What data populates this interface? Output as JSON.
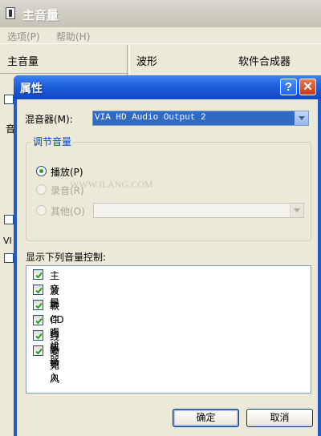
{
  "background_window": {
    "title": "主音量",
    "menu": [
      "选项(P)",
      "帮助(H)"
    ],
    "columns": [
      "主音量",
      "波形",
      "软件合成器"
    ],
    "fragments": {
      "vol_char": "音",
      "vi_text": "VI"
    }
  },
  "dialog": {
    "title": "属性",
    "help_glyph": "?",
    "close_glyph": "✕",
    "mixer": {
      "label": "混音器(M):",
      "value": "VIA HD Audio Output 2"
    },
    "adjust_group": {
      "label": "调节音量",
      "options": [
        {
          "label": "播放(P)",
          "selected": true,
          "enabled": true
        },
        {
          "label": "录音(R)",
          "selected": false,
          "enabled": false
        },
        {
          "label": "其他(O)",
          "selected": false,
          "enabled": false
        }
      ]
    },
    "watermark": "WWW.ILANG.COM",
    "controls_label": "显示下列音量控制:",
    "controls": [
      {
        "label": "主音量",
        "checked": true
      },
      {
        "label": "波形",
        "checked": true
      },
      {
        "label": "软件合成器",
        "checked": true
      },
      {
        "label": "CD 唱机",
        "checked": true
      },
      {
        "label": "线路输入",
        "checked": true
      },
      {
        "label": "麦克风",
        "checked": true
      }
    ],
    "ok_label": "确定",
    "cancel_label": "取消"
  },
  "colors": {
    "title_blue": "#1f5fd8",
    "selection": "#316ac5",
    "group_label": "#0046d5",
    "check_green": "#21a121"
  }
}
